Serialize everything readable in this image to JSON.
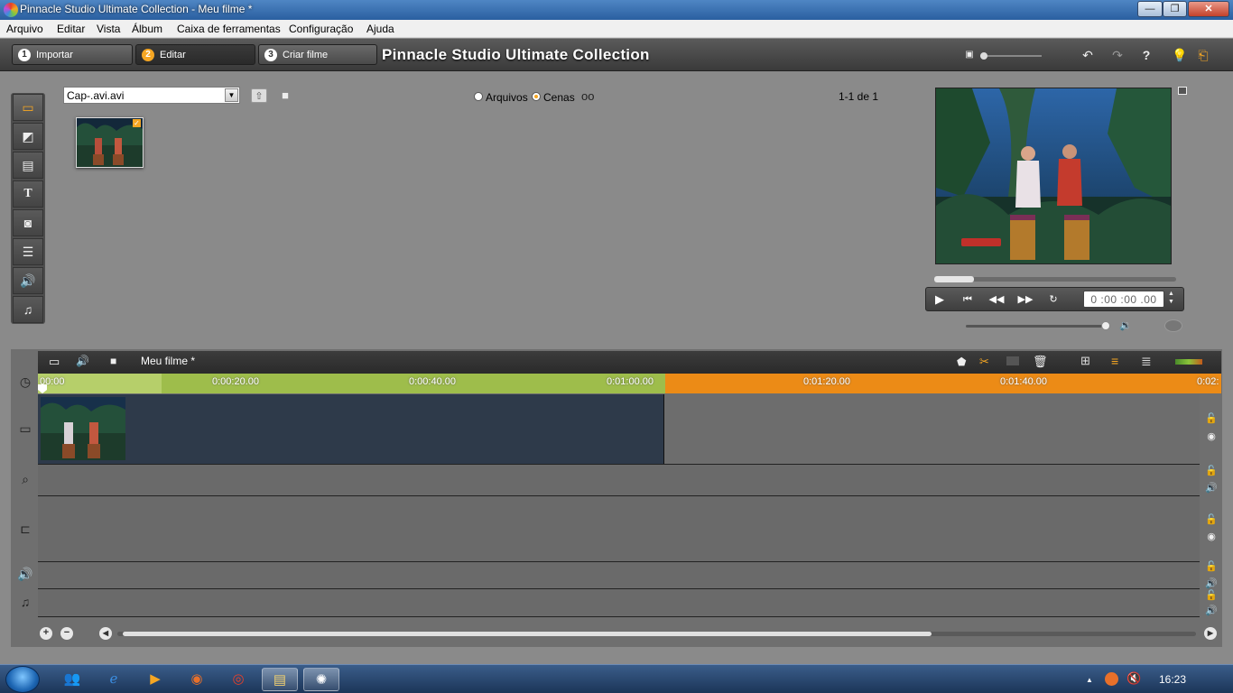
{
  "window": {
    "title": "Pinnacle Studio Ultimate Collection - Meu filme *",
    "minimize": "—",
    "maximize": "❐",
    "close": "✕"
  },
  "menu": [
    "Arquivo",
    "Editar",
    "Vista",
    "Álbum",
    "Caixa de ferramentas",
    "Configuração",
    "Ajuda"
  ],
  "steps": [
    {
      "num": "1",
      "label": "Importar"
    },
    {
      "num": "2",
      "label": "Editar"
    },
    {
      "num": "3",
      "label": "Criar filme"
    }
  ],
  "app_title": "Pinnacle Studio Ultimate Collection",
  "album": {
    "selected": "Cap-.avi.avi",
    "view_files": "Arquivos",
    "view_scenes": "Cenas",
    "count": "1-1 de 1",
    "active_view": "Cenas"
  },
  "player": {
    "timecode": "0 :00 :00 .00",
    "scrub_position_percent": 0,
    "volume_percent": 100
  },
  "timeline": {
    "project_name": "Meu filme *",
    "ruler_ticks": [
      "00:00",
      "0:00:20.00",
      "0:00:40.00",
      "0:01:00.00",
      "0:01:20.00",
      "0:01:40.00",
      "0:02:"
    ],
    "scroll_visible_percent": 75
  },
  "taskbar": {
    "clock": "16:23"
  },
  "colors": {
    "accent": "#f5a623",
    "ruler_green": "#9ebd4b",
    "ruler_orange": "#ec8b16"
  }
}
